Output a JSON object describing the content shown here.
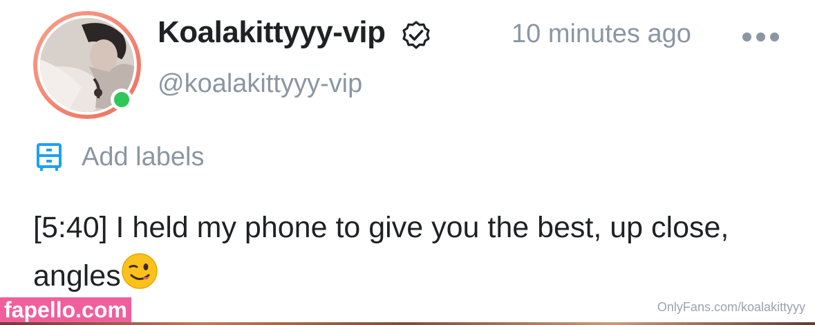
{
  "post_header": {
    "display_name": "Koalakittyyy-vip",
    "username": "@koalakittyyy-vip",
    "timestamp": "10 minutes ago",
    "verified_icon": "verified-badge-icon",
    "more_icon": "more-options-icon",
    "online_status": "online",
    "status_color": "#2ec75a",
    "ring_color": "#ef6f5e"
  },
  "labels": {
    "icon": "drawer-icon",
    "text": "Add labels",
    "icon_color": "#1da1f2"
  },
  "post": {
    "text": "[5:40] I held my phone to give you the best, up close, angles",
    "emoji": "😉"
  },
  "watermarks": {
    "left": "fapello.com",
    "right": "OnlyFans.com/koalakittyyy"
  }
}
